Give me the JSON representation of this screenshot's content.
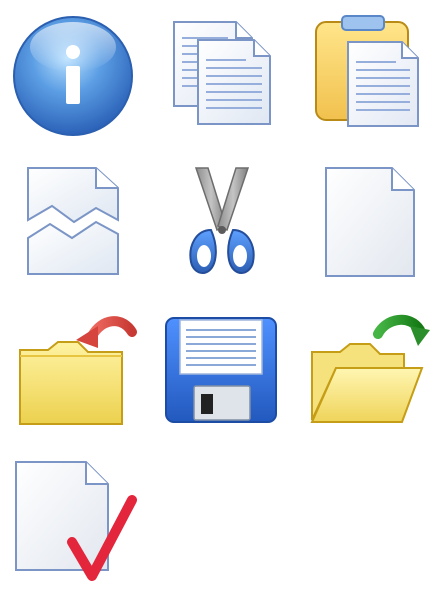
{
  "icon_grid": {
    "icons": [
      {
        "name": "info-icon"
      },
      {
        "name": "copy-icon"
      },
      {
        "name": "paste-icon"
      },
      {
        "name": "broken-document-icon"
      },
      {
        "name": "cut-icon"
      },
      {
        "name": "new-document-icon"
      },
      {
        "name": "folder-undo-icon"
      },
      {
        "name": "save-icon"
      },
      {
        "name": "open-folder-redo-icon"
      },
      {
        "name": "document-check-icon"
      }
    ]
  },
  "colors": {
    "info_blue": "#3f7fd0",
    "document_fill": "#f4f6fa",
    "document_outline": "#7b95c6",
    "folder_yellow": "#f4de63",
    "folder_outline": "#c59d16",
    "scissors_gray": "#8d8d8d",
    "scissors_blue": "#3d6fc0",
    "floppy_blue": "#2d6fd1",
    "undo_red": "#d6453d",
    "redo_green": "#2a8f2a",
    "check_red": "#e3263b"
  }
}
